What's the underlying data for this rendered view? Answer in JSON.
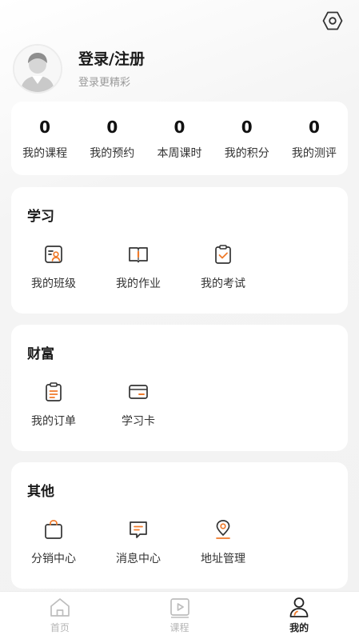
{
  "header": {
    "settings_icon": "gear-icon"
  },
  "profile": {
    "title": "登录/注册",
    "subtitle": "登录更精彩",
    "avatar_icon": "default-avatar"
  },
  "stats": [
    {
      "value": "0",
      "label": "我的课程"
    },
    {
      "value": "0",
      "label": "我的预约"
    },
    {
      "value": "0",
      "label": "本周课时"
    },
    {
      "value": "0",
      "label": "我的积分"
    },
    {
      "value": "0",
      "label": "我的测评"
    }
  ],
  "learn": {
    "title": "学习",
    "items": [
      {
        "label": "我的班级",
        "icon": "class-icon"
      },
      {
        "label": "我的作业",
        "icon": "homework-icon"
      },
      {
        "label": "我的考试",
        "icon": "exam-icon"
      }
    ]
  },
  "wealth": {
    "title": "财富",
    "items": [
      {
        "label": "我的订单",
        "icon": "order-icon"
      },
      {
        "label": "学习卡",
        "icon": "card-icon"
      }
    ]
  },
  "other": {
    "title": "其他",
    "items": [
      {
        "label": "分销中心",
        "icon": "bag-icon"
      },
      {
        "label": "消息中心",
        "icon": "message-icon"
      },
      {
        "label": "地址管理",
        "icon": "location-icon"
      }
    ]
  },
  "tabbar": {
    "items": [
      {
        "label": "首页",
        "icon": "home-icon"
      },
      {
        "label": "课程",
        "icon": "course-icon"
      },
      {
        "label": "我的",
        "icon": "profile-icon"
      }
    ],
    "active_index": 2
  },
  "colors": {
    "accent": "#f07a2a",
    "icon_stroke": "#333333",
    "tab_inactive": "#b5b5b5"
  }
}
